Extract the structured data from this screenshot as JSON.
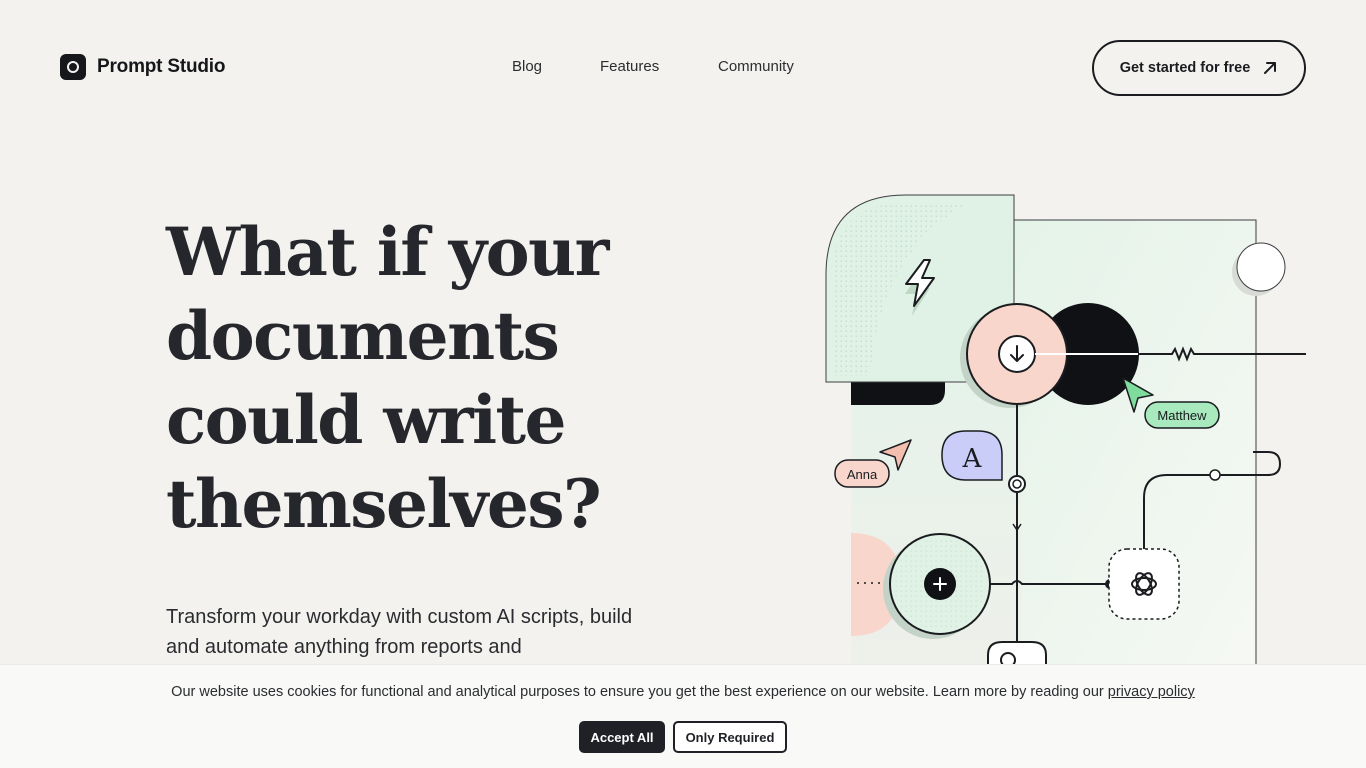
{
  "header": {
    "brand_name": "Prompt Studio",
    "nav": [
      {
        "label": "Blog"
      },
      {
        "label": "Features"
      },
      {
        "label": "Community"
      }
    ],
    "cta_label": "Get started for free",
    "cta_icon": "arrow-up-right-icon"
  },
  "hero": {
    "headline": "What if your documents could write themselves?",
    "subtext": "Transform your workday with custom AI scripts, build and automate anything from reports and"
  },
  "illustration": {
    "cursor_labels": {
      "left": "Anna",
      "right": "Matthew"
    },
    "letter_bubble": "A",
    "colors": {
      "mint": "#dff2e5",
      "peach": "#f8d6cb",
      "lavender": "#c9cdf8",
      "green_tag": "#a8e9bd",
      "dark": "#0f1114"
    }
  },
  "cookie_banner": {
    "message": "Our website uses cookies for functional and analytical purposes to ensure you get the best experience on our website. Learn more by reading our",
    "link_text": "privacy policy",
    "accept_label": "Accept All",
    "required_label": "Only Required"
  }
}
